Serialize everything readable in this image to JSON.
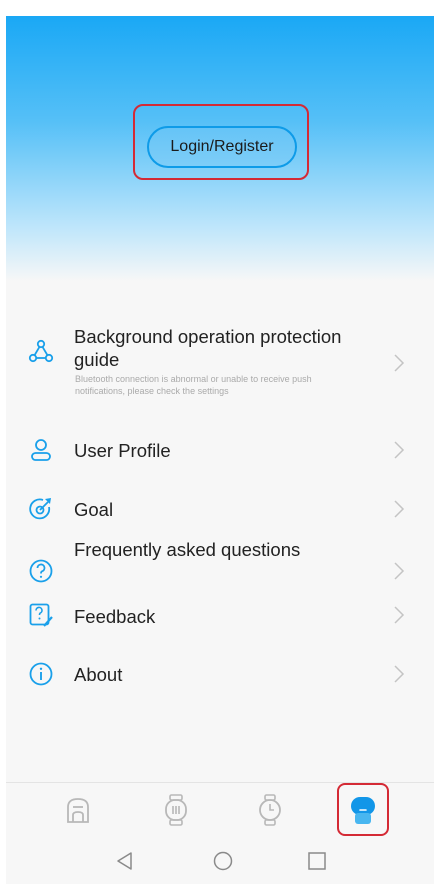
{
  "header": {
    "login_label": "Login/Register"
  },
  "menu": {
    "items": [
      {
        "label": "Background operation protection guide",
        "sub": "Bluetooth connection is abnormal or unable to receive push notifications, please check the settings",
        "icon": "triangle-nodes-icon"
      },
      {
        "label": "User Profile",
        "icon": "user-icon"
      },
      {
        "label": "Goal",
        "icon": "target-icon"
      },
      {
        "label": "Frequently asked questions",
        "icon": "question-circle-icon"
      },
      {
        "label": "Feedback",
        "icon": "feedback-icon"
      },
      {
        "label": "About",
        "icon": "info-icon"
      }
    ]
  },
  "tabbar": {
    "tabs": [
      "home-icon",
      "device-icon",
      "watch-icon",
      "profile-icon"
    ],
    "active": 3,
    "accent": "#1296e8",
    "inactive": "#b8b8b8"
  },
  "navbar": {
    "buttons": [
      "back-icon",
      "home-icon",
      "recents-icon"
    ]
  },
  "colors": {
    "accent": "#1aa0ea",
    "highlight": "#d42a35"
  }
}
